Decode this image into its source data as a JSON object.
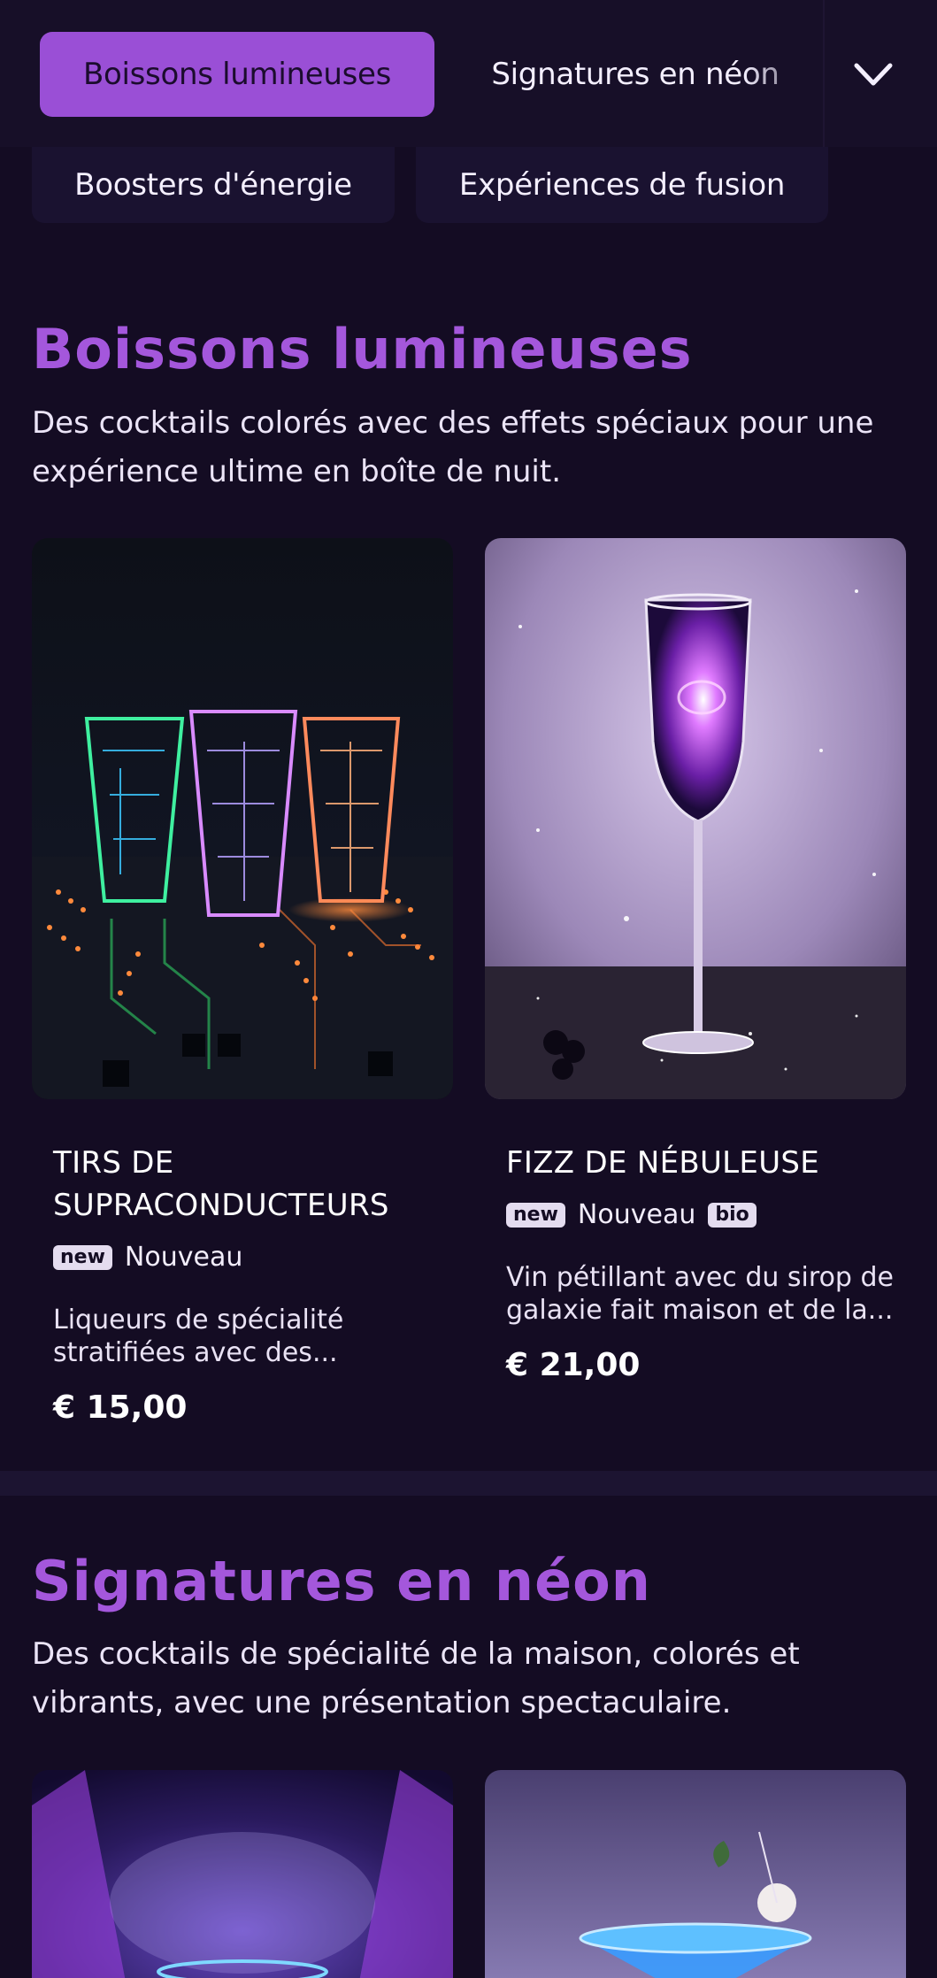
{
  "nav": {
    "active_tab": "Boissons lumineuses",
    "tabs": [
      "Signatures en néon",
      "Boosters d'énergie",
      "Expériences de fusion"
    ]
  },
  "sections": [
    {
      "title": "Boissons lumineuses",
      "description": "Des cocktails colorés avec des effets spéciaux pour une expérience ultime en boîte de nuit.",
      "items": [
        {
          "name_line1": "TIRS DE",
          "name_line2": "SUPRACONDUCTEURS",
          "badges": [
            {
              "tag": "new",
              "label": "Nouveau"
            }
          ],
          "desc_line1": "Liqueurs de spécialité",
          "desc_line2": "stratifiées avec des...",
          "price": "€ 15,00"
        },
        {
          "name": "FIZZ DE NÉBULEUSE",
          "badges": [
            {
              "tag": "new",
              "label": "Nouveau"
            },
            {
              "tag": "bio"
            }
          ],
          "desc_line1": "Vin pétillant avec du sirop de",
          "desc_line2": "galaxie fait maison et de la...",
          "price": "€ 21,00"
        }
      ]
    },
    {
      "title": "Signatures en néon",
      "description": "Des cocktails de spécialité de la maison, colorés et vibrants, avec une présentation spectaculaire."
    }
  ],
  "colors": {
    "background": "#140c23",
    "accent": "#9a4fd6",
    "title": "#a457dc"
  },
  "icons": {
    "menu_toggle": "chevron-down-icon"
  }
}
